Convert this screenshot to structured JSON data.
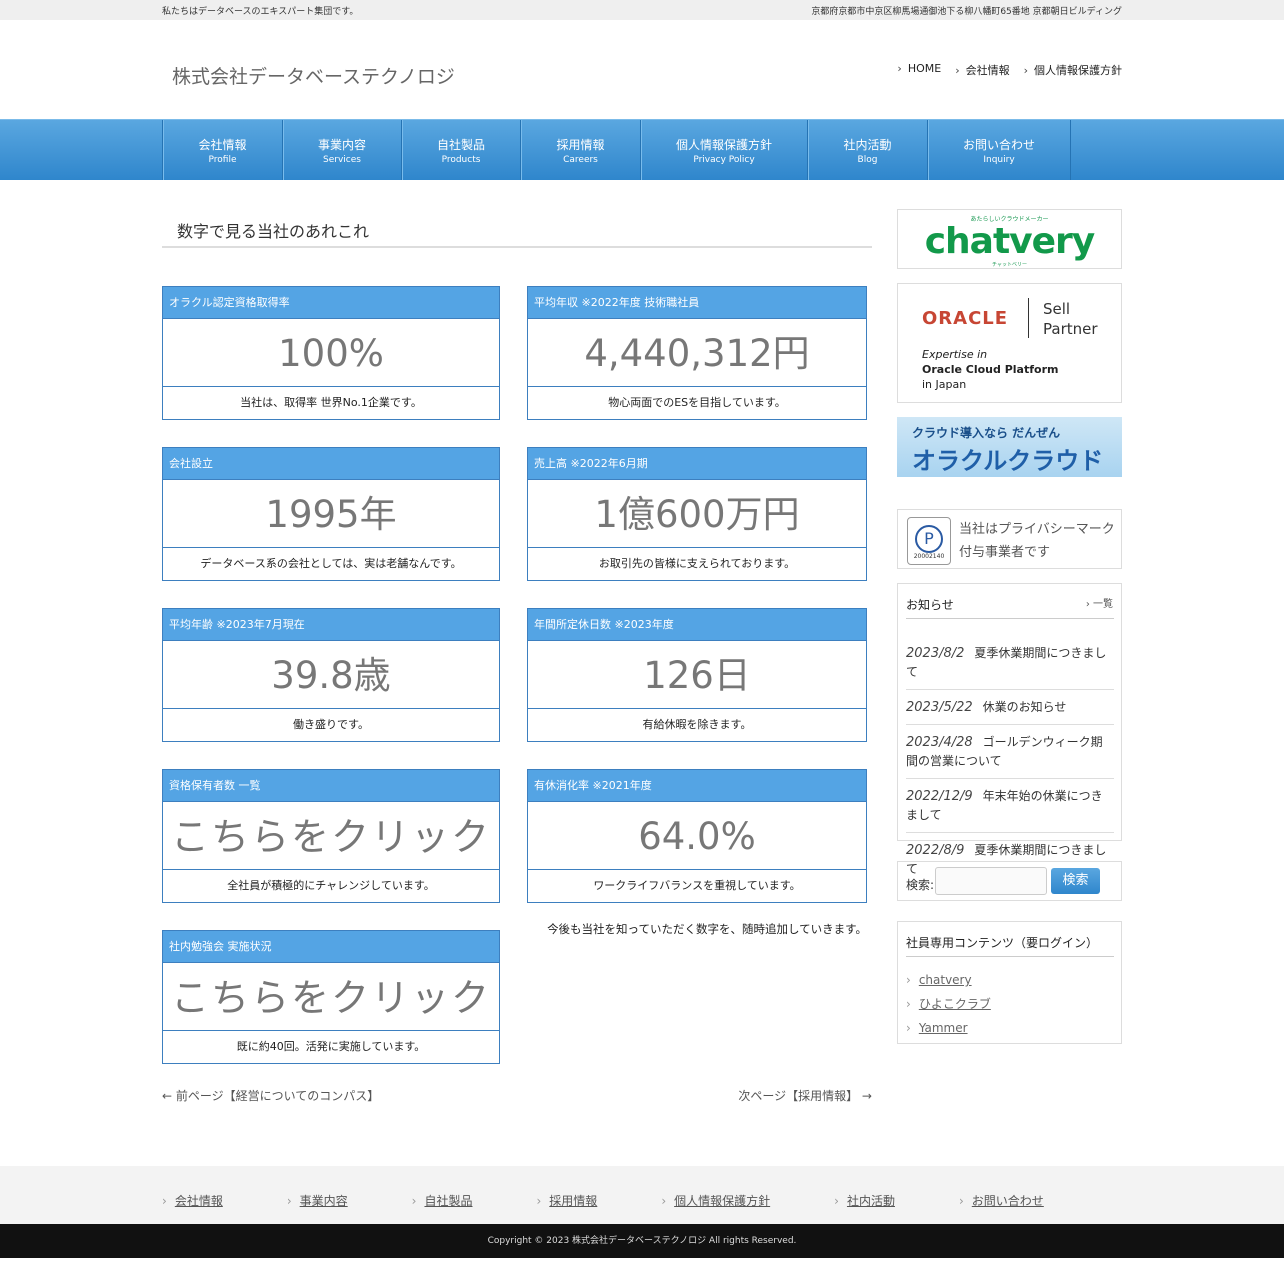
{
  "topbar": {
    "tagline": "私たちはデータベースのエキスパート集団です。",
    "address": "京都府京都市中京区柳馬場通御池下る柳八幡町65番地 京都朝日ビルディング"
  },
  "header": {
    "logo": "株式会社データベーステクノロジ",
    "nav": [
      "HOME",
      "会社情報",
      "個人情報保護方針"
    ]
  },
  "global_nav": [
    {
      "ja": "会社情報",
      "en": "Profile"
    },
    {
      "ja": "事業内容",
      "en": "Services"
    },
    {
      "ja": "自社製品",
      "en": "Products"
    },
    {
      "ja": "採用情報",
      "en": "Careers"
    },
    {
      "ja": "個人情報保護方針",
      "en": "Privacy Policy"
    },
    {
      "ja": "社内活動",
      "en": "Blog"
    },
    {
      "ja": "お問い合わせ",
      "en": "Inquiry"
    }
  ],
  "page_title": "数字で見る当社のあれこれ",
  "stats": [
    {
      "title": "オラクル認定資格取得率",
      "value": "100%",
      "caption": "当社は、取得率 世界No.1企業です。"
    },
    {
      "title": "平均年収 ※2022年度 技術職社員",
      "value": "4,440,312円",
      "caption": "物心両面でのESを目指しています。"
    },
    {
      "title": "会社設立",
      "value": "1995年",
      "caption": "データベース系の会社としては、実は老舗なんです。"
    },
    {
      "title": "売上高 ※2022年6月期",
      "value": "1億600万円",
      "caption": "お取引先の皆様に支えられております。"
    },
    {
      "title": "平均年齢 ※2023年7月現在",
      "value": "39.8歳",
      "caption": "働き盛りです。"
    },
    {
      "title": "年間所定休日数 ※2023年度",
      "value": "126日",
      "caption": "有給休暇を除きます。"
    },
    {
      "title": "資格保有者数 一覧",
      "value": "こちらをクリック",
      "caption": "全社員が積極的にチャレンジしています。"
    },
    {
      "title": "有休消化率 ※2021年度",
      "value": "64.0%",
      "caption": "ワークライフバランスを重視しています。"
    },
    {
      "title": "社内勉強会 実施状況",
      "value": "こちらをクリック",
      "caption": "既に約40回。活発に実施しています。"
    }
  ],
  "note": "今後も当社を知っていただく数字を、随時追加していきます。",
  "pager": {
    "prev": "← 前ページ【経営についてのコンパス】",
    "next": "次ページ【採用情報】 →"
  },
  "sidebar": {
    "chatvery": {
      "tagline": "あたらしいクラウドメーカー",
      "name": "chatvery",
      "kana": "チャットベリー"
    },
    "oracle": {
      "brand": "ORACLE",
      "sell": "Sell",
      "partner": "Partner",
      "line1": "Expertise in",
      "line2": "Oracle Cloud Platform",
      "line3": "in Japan"
    },
    "cloud": {
      "line1": "クラウド導入なら だんぜん",
      "line2": "オラクルクラウド"
    },
    "pmark": {
      "number": "20002140",
      "text1": "当社はプライバシーマーク",
      "text2": "付与事業者です"
    },
    "news": {
      "title": "お知らせ",
      "more": "一覧",
      "items": [
        {
          "date": "2023/8/2",
          "text": "夏季休業期間につきまして"
        },
        {
          "date": "2023/5/22",
          "text": "休業のお知らせ"
        },
        {
          "date": "2023/4/28",
          "text": "ゴールデンウィーク期間の営業について"
        },
        {
          "date": "2022/12/9",
          "text": "年末年始の休業につきまして"
        },
        {
          "date": "2022/8/9",
          "text": "夏季休業期間につきまして"
        }
      ]
    },
    "search": {
      "label": "検索:",
      "button": "検索"
    },
    "staff": {
      "title": "社員専用コンテンツ（要ログイン）",
      "links": [
        "chatvery",
        "ひよこクラブ",
        "Yammer"
      ]
    }
  },
  "footer": {
    "nav": [
      "会社情報",
      "事業内容",
      "自社製品",
      "採用情報",
      "個人情報保護方針",
      "社内活動",
      "お問い合わせ"
    ],
    "copyright": "Copyright © 2023 株式会社データベーステクノロジ All rights Reserved."
  }
}
